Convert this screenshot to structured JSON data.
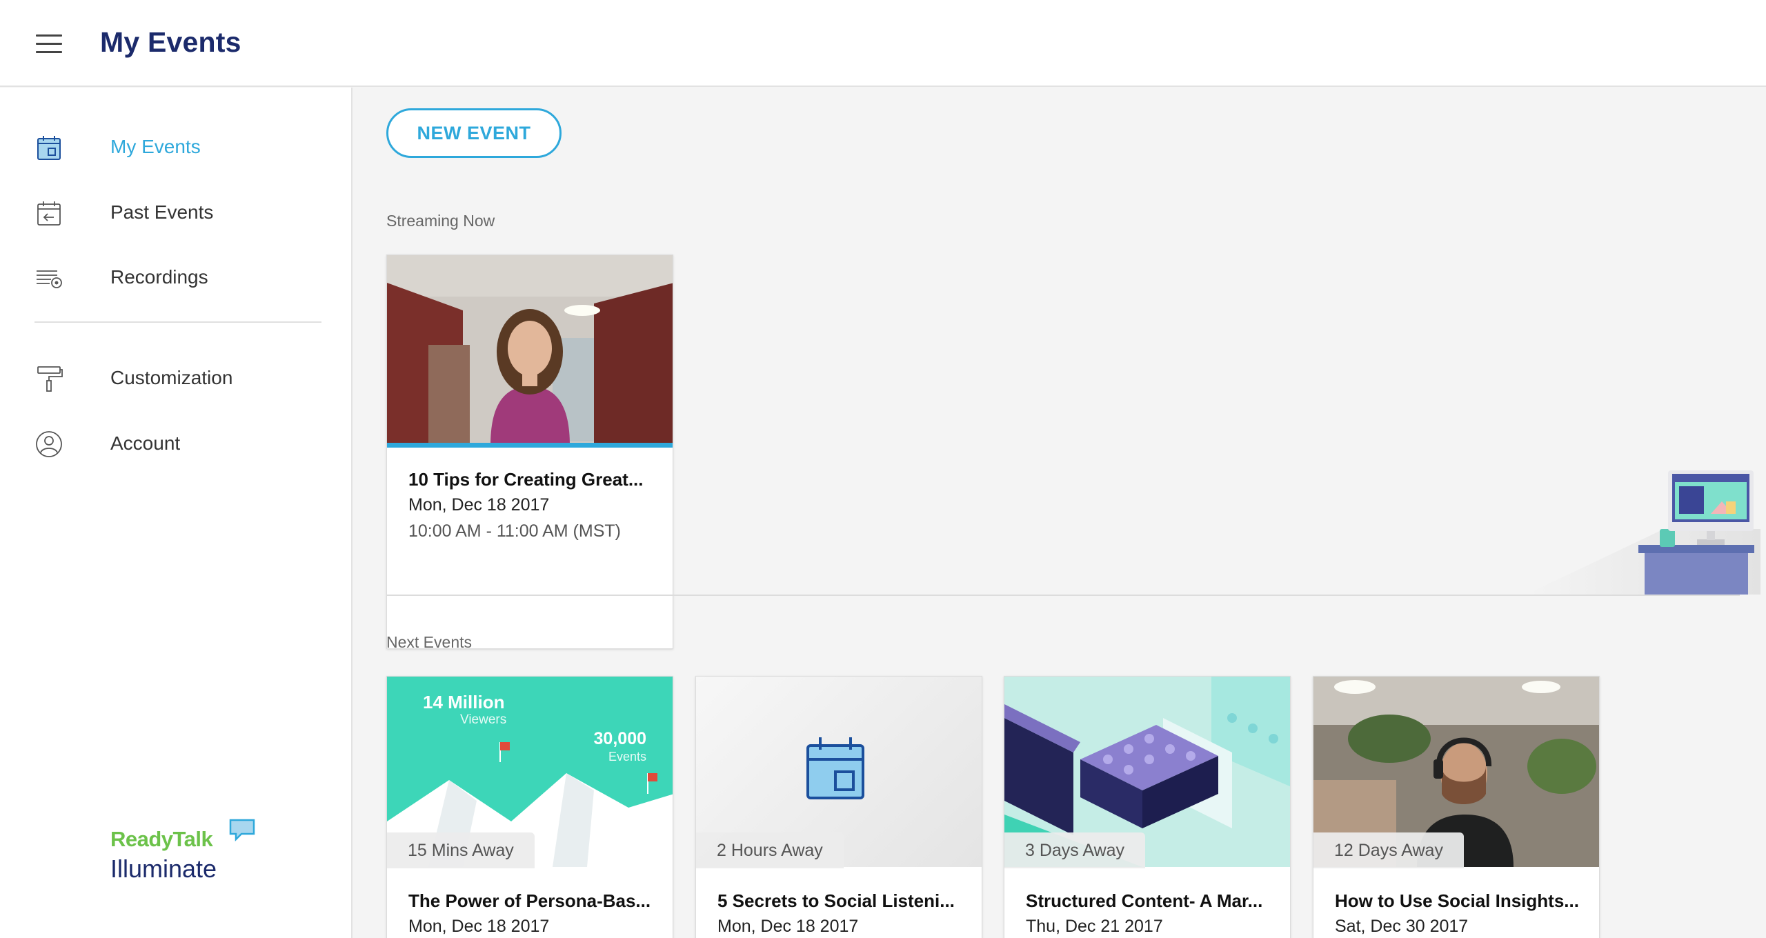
{
  "header": {
    "title": "My Events"
  },
  "sidebar": {
    "items": [
      {
        "label": "My Events",
        "icon": "calendar-icon"
      },
      {
        "label": "Past Events",
        "icon": "calendar-back-icon"
      },
      {
        "label": "Recordings",
        "icon": "recordings-icon"
      },
      {
        "label": "Customization",
        "icon": "paint-roller-icon"
      },
      {
        "label": "Account",
        "icon": "user-circle-icon"
      }
    ],
    "brand": {
      "name_top": "ReadyTalk",
      "name_bottom": "Illuminate"
    }
  },
  "main": {
    "new_event_label": "NEW EVENT",
    "streaming_label": "Streaming Now",
    "streaming_card": {
      "title": "10 Tips for Creating Great...",
      "date": "Mon, Dec 18 2017",
      "time": "10:00 AM - 11:00 AM (MST)"
    },
    "next_label": "Next Events",
    "next_cards": [
      {
        "badge": "15 Mins Away",
        "title": "The Power of Persona-Bas...",
        "date": "Mon, Dec 18 2017",
        "thumb_text": {
          "big": "14 Million",
          "big_sub": "Viewers",
          "small": "30,000",
          "small_sub": "Events"
        }
      },
      {
        "badge": "2 Hours Away",
        "title": "5 Secrets to Social Listeni...",
        "date": "Mon, Dec 18 2017"
      },
      {
        "badge": "3 Days Away",
        "title": "Structured Content- A Mar...",
        "date": "Thu, Dec 21 2017"
      },
      {
        "badge": "12 Days Away",
        "title": "How to Use Social Insights...",
        "date": "Sat, Dec 30 2017"
      }
    ]
  },
  "colors": {
    "accent": "#2ea8db",
    "title_navy": "#1b2a6b",
    "brand_green": "#6cc24a"
  }
}
